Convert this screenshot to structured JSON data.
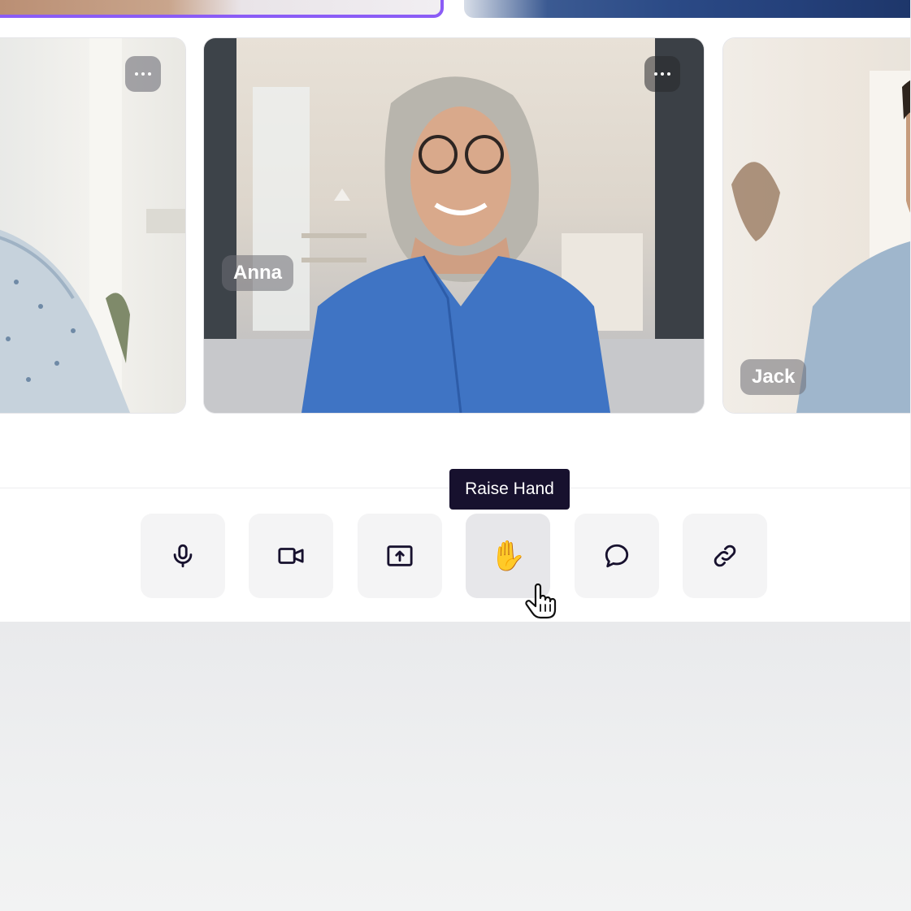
{
  "participants": {
    "top_left": {
      "selected": true,
      "highlight_color": "#8b5cf6"
    },
    "top_right": {},
    "left": {
      "more_icon": "more-horizontal-icon"
    },
    "center": {
      "name": "Anna",
      "more_icon": "more-horizontal-icon"
    },
    "right": {
      "name": "Jack"
    }
  },
  "toolbar": {
    "tooltip": "Raise Hand",
    "buttons": [
      {
        "id": "mic",
        "icon": "microphone-icon"
      },
      {
        "id": "camera",
        "icon": "video-camera-icon"
      },
      {
        "id": "share",
        "icon": "screen-share-icon"
      },
      {
        "id": "raise-hand",
        "icon": "raised-hand-icon",
        "glyph": "✋",
        "active": true
      },
      {
        "id": "chat",
        "icon": "chat-bubble-icon"
      },
      {
        "id": "link",
        "icon": "link-icon"
      }
    ],
    "icon_color": "#17112e"
  },
  "cursor": {
    "icon": "pointer-hand-cursor-icon"
  }
}
